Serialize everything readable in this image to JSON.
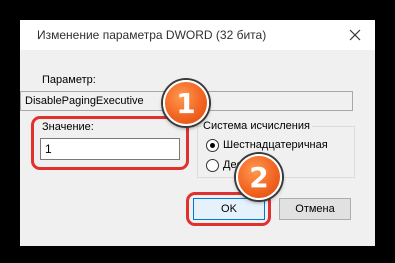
{
  "window": {
    "title": "Изменение параметра DWORD (32 бита)"
  },
  "param": {
    "label": "Параметр:",
    "value": "DisablePagingExecutive"
  },
  "value_field": {
    "label": "Значение:",
    "value": "1"
  },
  "radix": {
    "title": "Система исчисления",
    "options": [
      {
        "label": "Шестнадцатеричная",
        "selected": true
      },
      {
        "label": "Десят",
        "selected": false
      }
    ]
  },
  "buttons": {
    "ok": "OK",
    "cancel": "Отмена"
  },
  "badges": [
    "1",
    "2"
  ],
  "colors": {
    "highlight": "#e0312f",
    "badge": "#f26522"
  }
}
